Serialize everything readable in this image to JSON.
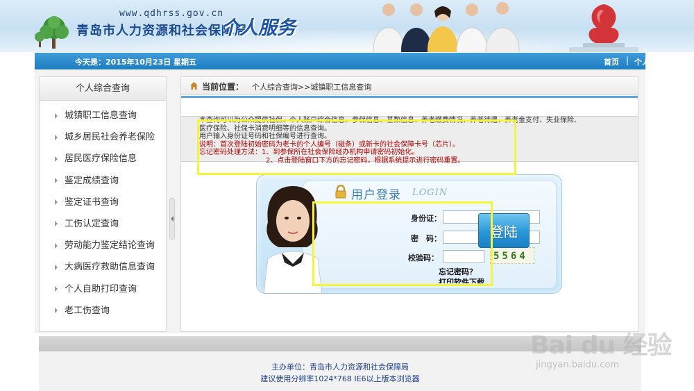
{
  "header": {
    "site_url": "www.qdhrss.gov.cn",
    "org_title": "青岛市人力资源和社会保障局",
    "service_title": "个人服务"
  },
  "datebar": {
    "date_label": "今天是：",
    "date_value": "2015年10月23日 星期五",
    "nav_home": "首页",
    "nav_separator": "|",
    "nav_personal": "个人信息管理"
  },
  "sidebar": {
    "title": "个人综合查询",
    "items": [
      {
        "label": "城镇职工信息查询"
      },
      {
        "label": "城乡居民社会养老保险"
      },
      {
        "label": "居民医疗保险信息"
      },
      {
        "label": "鉴定成绩查询"
      },
      {
        "label": "鉴定证书查询"
      },
      {
        "label": "工伤认定查询"
      },
      {
        "label": "劳动能力鉴定结论查询"
      },
      {
        "label": "大病医疗救助信息查询"
      },
      {
        "label": "个人自助打印查询"
      },
      {
        "label": "老工伤查询"
      }
    ]
  },
  "breadcrumb": {
    "label": "当前位置：",
    "path": "个人综合查询>>城镇职工信息查询"
  },
  "notice": {
    "line1": "本查询可以为公众提供社保、个人账户综合信息、参保信息、基数信息、养老缴费情况、养老待遇、养老金支付、失业保险、",
    "line2": "医疗保险、社保卡消费明细等的信息查询。",
    "line3": "用户输入身份证号码和社保编号进行查询。",
    "line4": "说明：首次登陆初始密码为老卡的个人编号（磁条）或新卡的社会保障卡号（芯片）。",
    "line5": "忘记密码处理方法：1、到参保所在社会保险经办机构申请密码初始化。",
    "line6": "2、点击登陆窗口下方的忘记密码，根据系统提示进行密码重置。"
  },
  "login": {
    "title": "用户登录",
    "title_en": "LOGIN",
    "id_label": "身份证：",
    "id_value": "",
    "pwd_label": "密　码：",
    "pwd_value": "",
    "captcha_label": "校验码：",
    "captcha_value": "",
    "captcha_code": "5564",
    "forgot_link": "忘记密码？",
    "print_link": "打印软件下载",
    "button_label": "登陆"
  },
  "footer": {
    "host": "主办单位：青岛市人力资源和社会保障局",
    "tip": "建议使用分辨率1024*768 IE6以上版本浏览器"
  },
  "watermark": {
    "brand": "Bai du 经验",
    "url": "jingyan.baidu.com"
  },
  "colors": {
    "date_bar": "#1e7cc0",
    "highlight": "#f5f53a",
    "notice_red": "#b50000",
    "login_button": "#2a96d8"
  }
}
